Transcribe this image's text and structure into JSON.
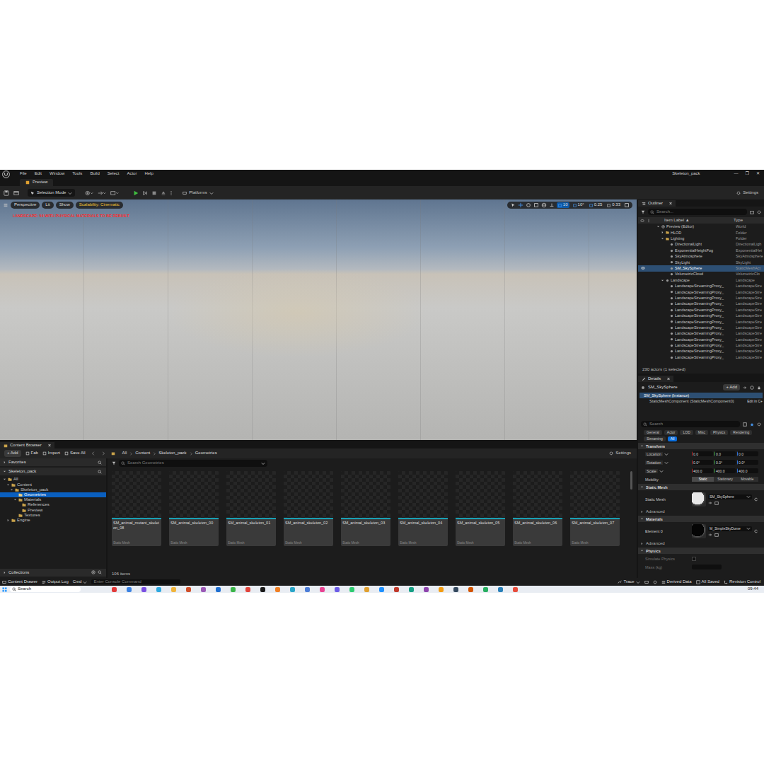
{
  "window": {
    "title": "Skeleton_pack",
    "controls": [
      "—",
      "❐",
      "✕"
    ]
  },
  "menu": [
    "File",
    "Edit",
    "Window",
    "Tools",
    "Build",
    "Select",
    "Actor",
    "Help"
  ],
  "level_tab": {
    "label": "Preview",
    "selected": true
  },
  "toolbar": {
    "mode": "Selection Mode",
    "platforms": "Platforms",
    "settings": "Settings"
  },
  "viewport": {
    "buttons": [
      "Perspective",
      "Lit",
      "Show"
    ],
    "scalability": "Scalability: Cinematic",
    "snaps": [
      {
        "label": "10",
        "active": true
      },
      {
        "label": "10°",
        "active": true
      },
      {
        "label": "0.25",
        "active": true
      },
      {
        "label": "0.33",
        "active": false
      }
    ],
    "warning": "LANDSCAPE: 54 WITH PHYSICAL MATERIALS TO BE REBUILT"
  },
  "outliner": {
    "tab": "Outliner",
    "search": "Search...",
    "columns": [
      "Item Label ▲",
      "Type"
    ],
    "rows": [
      {
        "label": "Preview (Editor)",
        "type": "World",
        "depth": 0,
        "kind": "world",
        "expandable": true,
        "expanded": true,
        "eye": false,
        "selected": false
      },
      {
        "label": "HLOD",
        "type": "Folder",
        "depth": 1,
        "kind": "folder",
        "expandable": true,
        "expanded": false,
        "eye": false,
        "selected": false
      },
      {
        "label": "Lighting",
        "type": "Folder",
        "depth": 1,
        "kind": "folder",
        "expandable": true,
        "expanded": true,
        "eye": false,
        "selected": false
      },
      {
        "label": "DirectionalLight",
        "type": "DirectionalLigh",
        "depth": 2,
        "kind": "actor",
        "expandable": false,
        "expanded": false,
        "eye": false,
        "selected": false
      },
      {
        "label": "ExponentialHeightFog",
        "type": "ExponentialHei",
        "depth": 2,
        "kind": "actor",
        "expandable": false,
        "expanded": false,
        "eye": false,
        "selected": false
      },
      {
        "label": "SkyAtmosphere",
        "type": "SkyAtmosphere",
        "depth": 2,
        "kind": "actor",
        "expandable": false,
        "expanded": false,
        "eye": false,
        "selected": false
      },
      {
        "label": "SkyLight",
        "type": "SkyLight",
        "depth": 2,
        "kind": "actor",
        "expandable": false,
        "expanded": false,
        "eye": false,
        "selected": false
      },
      {
        "label": "SM_SkySphere",
        "type": "StaticMeshAct",
        "depth": 2,
        "kind": "actor",
        "expandable": false,
        "expanded": false,
        "eye": true,
        "selected": true
      },
      {
        "label": "VolumetricCloud",
        "type": "VolumetricClo",
        "depth": 2,
        "kind": "actor",
        "expandable": false,
        "expanded": false,
        "eye": false,
        "selected": false
      },
      {
        "label": "Landscape",
        "type": "Landscape",
        "depth": 1,
        "kind": "actor",
        "expandable": true,
        "expanded": true,
        "eye": false,
        "selected": false
      },
      {
        "label": "LandscapeStreamingProxy_",
        "type": "LandscapeStre",
        "depth": 2,
        "kind": "actor",
        "expandable": false,
        "expanded": false,
        "eye": false,
        "selected": false
      },
      {
        "label": "LandscapeStreamingProxy_",
        "type": "LandscapeStre",
        "depth": 2,
        "kind": "actor",
        "expandable": false,
        "expanded": false,
        "eye": false,
        "selected": false
      },
      {
        "label": "LandscapeStreamingProxy_",
        "type": "LandscapeStre",
        "depth": 2,
        "kind": "actor",
        "expandable": false,
        "expanded": false,
        "eye": false,
        "selected": false
      },
      {
        "label": "LandscapeStreamingProxy_",
        "type": "LandscapeStre",
        "depth": 2,
        "kind": "actor",
        "expandable": false,
        "expanded": false,
        "eye": false,
        "selected": false
      },
      {
        "label": "LandscapeStreamingProxy_",
        "type": "LandscapeStre",
        "depth": 2,
        "kind": "actor",
        "expandable": false,
        "expanded": false,
        "eye": false,
        "selected": false
      },
      {
        "label": "LandscapeStreamingProxy_",
        "type": "LandscapeStre",
        "depth": 2,
        "kind": "actor",
        "expandable": false,
        "expanded": false,
        "eye": false,
        "selected": false
      },
      {
        "label": "LandscapeStreamingProxy_",
        "type": "LandscapeStre",
        "depth": 2,
        "kind": "actor",
        "expandable": false,
        "expanded": false,
        "eye": false,
        "selected": false
      },
      {
        "label": "LandscapeStreamingProxy_",
        "type": "LandscapeStre",
        "depth": 2,
        "kind": "actor",
        "expandable": false,
        "expanded": false,
        "eye": false,
        "selected": false
      },
      {
        "label": "LandscapeStreamingProxy_",
        "type": "LandscapeStre",
        "depth": 2,
        "kind": "actor",
        "expandable": false,
        "expanded": false,
        "eye": false,
        "selected": false
      },
      {
        "label": "LandscapeStreamingProxy_",
        "type": "LandscapeStre",
        "depth": 2,
        "kind": "actor",
        "expandable": false,
        "expanded": false,
        "eye": false,
        "selected": false
      },
      {
        "label": "LandscapeStreamingProxy_",
        "type": "LandscapeStre",
        "depth": 2,
        "kind": "actor",
        "expandable": false,
        "expanded": false,
        "eye": false,
        "selected": false
      },
      {
        "label": "LandscapeStreamingProxy_",
        "type": "LandscapeStre",
        "depth": 2,
        "kind": "actor",
        "expandable": false,
        "expanded": false,
        "eye": false,
        "selected": false
      },
      {
        "label": "LandscapeStreamingProxy_",
        "type": "LandscapeStre",
        "depth": 2,
        "kind": "actor",
        "expandable": false,
        "expanded": false,
        "eye": false,
        "selected": false
      }
    ],
    "footer": "230 actors (1 selected)"
  },
  "details": {
    "tab": "Details",
    "actor": "SM_SkySphere",
    "add": "+ Add",
    "components": [
      {
        "label": "SM_SkySphere (Instance)",
        "selected": true
      },
      {
        "label": "StaticMeshComponent (StaticMeshComponent0)",
        "selected": false
      }
    ],
    "edit_link": "Edit in C+",
    "search": "Search",
    "filters": [
      {
        "label": "General",
        "selected": false
      },
      {
        "label": "Actor",
        "selected": false
      },
      {
        "label": "LOD",
        "selected": false
      },
      {
        "label": "Misc",
        "selected": false
      },
      {
        "label": "Physics",
        "selected": false
      },
      {
        "label": "Rendering",
        "selected": false
      },
      {
        "label": "Streaming",
        "selected": false
      },
      {
        "label": "All",
        "selected": true
      }
    ],
    "sections": [
      {
        "title": "Transform",
        "rows": [
          {
            "kind": "vector",
            "label": "Location",
            "values": [
              "0.0",
              "0.0",
              "0.0"
            ]
          },
          {
            "kind": "vector",
            "label": "Rotation",
            "values": [
              "0.0°",
              "0.0°",
              "0.0°"
            ]
          },
          {
            "kind": "vector",
            "label": "Scale",
            "values": [
              "400.0",
              "400.0",
              "400.0"
            ]
          },
          {
            "kind": "choice",
            "label": "Mobility",
            "options": [
              {
                "label": "Static",
                "selected": true
              },
              {
                "label": "Stationary",
                "selected": false
              },
              {
                "label": "Movable",
                "selected": false
              }
            ]
          }
        ]
      },
      {
        "title": "Static Mesh",
        "rows": [
          {
            "kind": "asset",
            "label": "Static Mesh",
            "value": "SM_SkySphere",
            "color": "#e6e6e6"
          },
          {
            "kind": "advanced",
            "label": "Advanced"
          }
        ]
      },
      {
        "title": "Materials",
        "rows": [
          {
            "kind": "asset",
            "label": "Element 0",
            "value": "M_SimpleSkyDome",
            "color": "#050505"
          },
          {
            "kind": "advanced",
            "label": "Advanced"
          }
        ]
      },
      {
        "title": "Physics",
        "rows": [
          {
            "kind": "checkbox",
            "label": "Simulate Physics",
            "checked": false,
            "disabled": true
          },
          {
            "kind": "field",
            "label": "Mass (kg)",
            "value": "",
            "disabled": true
          }
        ]
      }
    ]
  },
  "content_browser": {
    "tab": "Content Browser",
    "actions": [
      "+ Add",
      "Fab",
      "Import",
      "Save All"
    ],
    "path": [
      "All",
      "Content",
      "Skeleton_pack",
      "Geometries"
    ],
    "settings": "Settings",
    "favorites": "Favorites",
    "root": "Skeleton_pack",
    "tree": [
      {
        "label": "All",
        "depth": 0,
        "expandable": true,
        "expanded": true,
        "selected": false
      },
      {
        "label": "Content",
        "depth": 1,
        "expandable": true,
        "expanded": true,
        "selected": false
      },
      {
        "label": "Skeleton_pack",
        "depth": 2,
        "expandable": true,
        "expanded": true,
        "selected": false
      },
      {
        "label": "Geometries",
        "depth": 3,
        "expandable": false,
        "expanded": false,
        "selected": true
      },
      {
        "label": "Materials",
        "depth": 3,
        "expandable": true,
        "expanded": true,
        "selected": false
      },
      {
        "label": "References",
        "depth": 4,
        "expandable": false,
        "expanded": false,
        "selected": false
      },
      {
        "label": "Preview",
        "depth": 4,
        "expandable": false,
        "expanded": false,
        "selected": false
      },
      {
        "label": "Textures",
        "depth": 3,
        "expandable": false,
        "expanded": false,
        "selected": false
      },
      {
        "label": "Engine",
        "depth": 1,
        "expandable": true,
        "expanded": false,
        "selected": false
      }
    ],
    "collections": "Collections",
    "search": "Search Geometries",
    "count": "106 items",
    "assets": [
      {
        "name": "SM_animal_mutant_skeleton_08",
        "type": "Static Mesh"
      },
      {
        "name": "SM_animal_skeleton_00",
        "type": "Static Mesh"
      },
      {
        "name": "SM_animal_skeleton_01",
        "type": "Static Mesh"
      },
      {
        "name": "SM_animal_skeleton_02",
        "type": "Static Mesh"
      },
      {
        "name": "SM_animal_skeleton_03",
        "type": "Static Mesh"
      },
      {
        "name": "SM_animal_skeleton_04",
        "type": "Static Mesh"
      },
      {
        "name": "SM_animal_skeleton_05",
        "type": "Static Mesh"
      },
      {
        "name": "SM_animal_skeleton_06",
        "type": "Static Mesh"
      },
      {
        "name": "SM_animal_skeleton_07",
        "type": "Static Mesh"
      }
    ]
  },
  "status_bar": {
    "content_drawer": "Content Drawer",
    "output_log": "Output Log",
    "cmd": "Cmd",
    "console_placeholder": "Enter Console Command",
    "trace": "Trace",
    "derived_data": "Derived Data",
    "saved": "All Saved",
    "revision": "Revision Control"
  },
  "taskbar": {
    "search": "Search",
    "time": "09:44"
  }
}
